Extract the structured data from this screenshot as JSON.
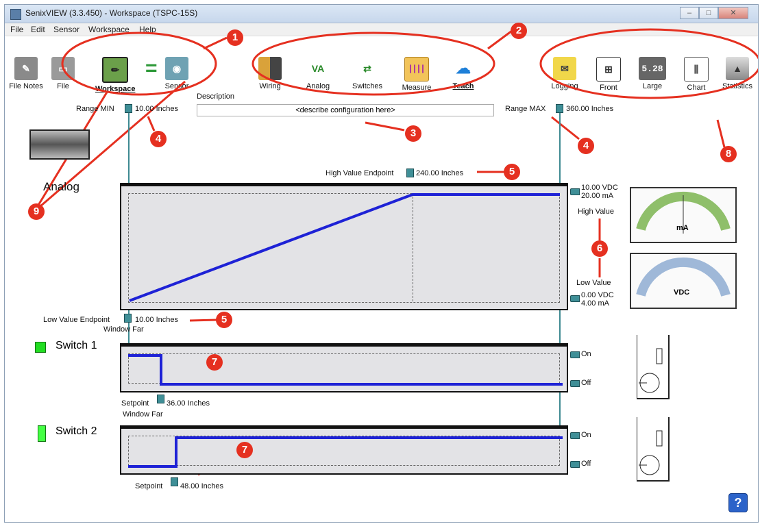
{
  "window": {
    "title": "SenixVIEW (3.3.450) - Workspace (TSPC-15S)"
  },
  "menu": [
    "File",
    "Edit",
    "Sensor",
    "Workspace",
    "Help"
  ],
  "toolbar": {
    "left": [
      {
        "label": "File Notes",
        "icon": "notes-icon"
      },
      {
        "label": "File",
        "icon": "folder-icon"
      },
      {
        "label": "Workspace",
        "icon": "pencil-icon"
      },
      {
        "label": "Sensor",
        "icon": "sensor-icon"
      }
    ],
    "equals": "=",
    "middle": [
      {
        "label": "Wiring",
        "icon": "wiring-icon"
      },
      {
        "label": "Analog",
        "icon": "va-icon",
        "glyph": "VA"
      },
      {
        "label": "Switches",
        "icon": "switches-icon"
      },
      {
        "label": "Measure",
        "icon": "ruler-icon"
      },
      {
        "label": "Teach",
        "icon": "teach-icon"
      }
    ],
    "right": [
      {
        "label": "Logging",
        "icon": "logging-icon"
      },
      {
        "label": "Front",
        "icon": "front-icon"
      },
      {
        "label": "Large",
        "icon": "large-icon",
        "glyph": "5.28"
      },
      {
        "label": "Chart",
        "icon": "chart-icon"
      },
      {
        "label": "Statistics",
        "icon": "statistics-icon"
      }
    ]
  },
  "description": {
    "label": "Description",
    "value": "<describe configuration here>"
  },
  "range": {
    "min_label": "Range MIN",
    "min_value": "10.00 Inches",
    "max_label": "Range MAX",
    "max_value": "360.00 Inches"
  },
  "analog": {
    "title": "Analog",
    "high_endpoint_label": "High Value Endpoint",
    "high_endpoint_value": "240.00 Inches",
    "low_endpoint_label": "Low Value Endpoint",
    "low_endpoint_value": "10.00 Inches",
    "window_far": "Window Far",
    "high_vdc": "10.00 VDC",
    "high_ma": "20.00 mA",
    "high_value": "High Value",
    "low_value": "Low Value",
    "low_vdc": "0.00 VDC",
    "low_ma": "4.00 mA",
    "meter1_unit": "mA",
    "meter2_unit": "VDC"
  },
  "switch1": {
    "title": "Switch 1",
    "on": "On",
    "off": "Off",
    "setpoint_label": "Setpoint",
    "setpoint_value": "36.00 Inches",
    "window_far": "Window Far",
    "led_color": "#22dd22"
  },
  "switch2": {
    "title": "Switch 2",
    "on": "On",
    "off": "Off",
    "setpoint_label": "Setpoint",
    "setpoint_value": "48.00 Inches",
    "led_color": "#44ff44"
  },
  "annotations": [
    "1",
    "2",
    "3",
    "4",
    "4",
    "5",
    "5",
    "6",
    "7",
    "7",
    "8",
    "9"
  ],
  "colors": {
    "accent_blue": "#1b2fd6",
    "annotation_red": "#e53020",
    "marker_teal": "#3f8f97"
  }
}
